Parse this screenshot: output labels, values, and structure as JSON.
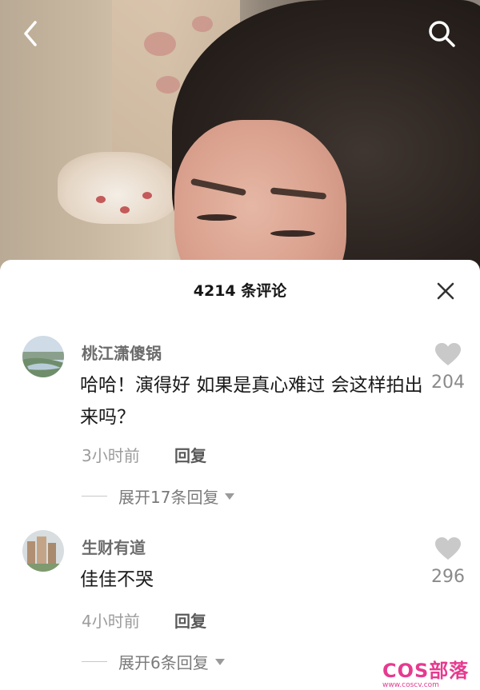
{
  "header": {
    "back_icon": "chevron-left-icon",
    "search_icon": "search-icon"
  },
  "comments_panel": {
    "title": "4214 条评论",
    "close_icon": "close-icon",
    "comments": [
      {
        "username": "桃江潇傻锅",
        "text": "哈哈！演得好 如果是真心难过 会这样拍出来吗？",
        "time": "3小时前",
        "reply_label": "回复",
        "likes": "204",
        "expand_label": "展开17条回复"
      },
      {
        "username": "生财有道",
        "text": "佳佳不哭",
        "time": "4小时前",
        "reply_label": "回复",
        "likes": "296",
        "expand_label": "展开6条回复"
      }
    ]
  },
  "watermark": {
    "brand": "COS部落",
    "url": "www.coscv.com"
  },
  "colors": {
    "watermark": "#e63a8f",
    "heart": "#c9c9c9"
  }
}
